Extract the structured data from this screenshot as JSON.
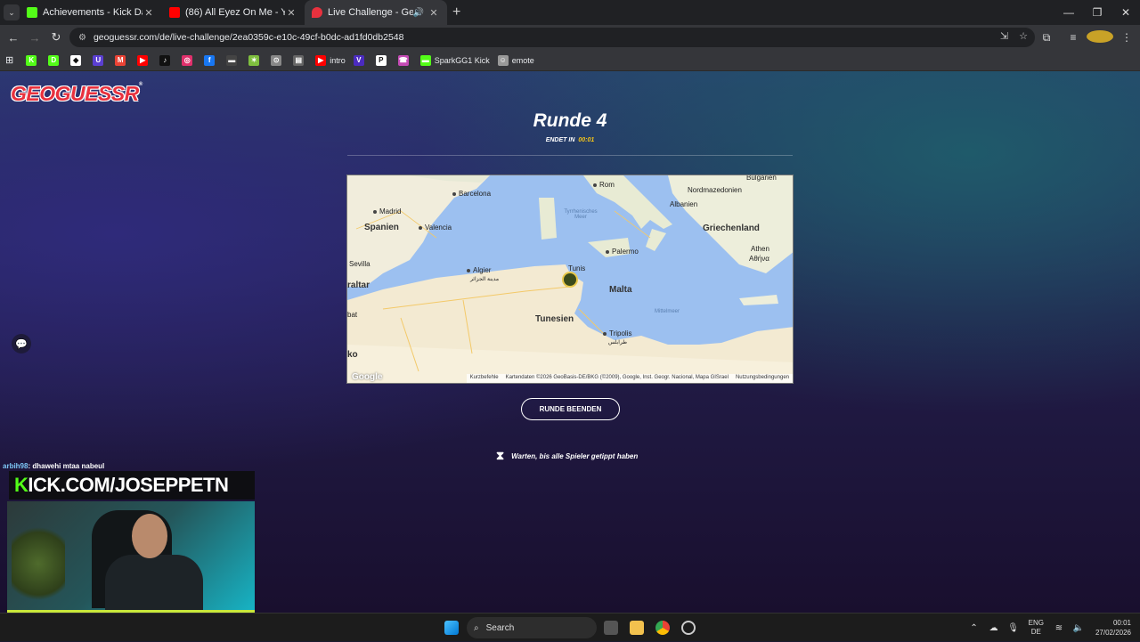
{
  "browser": {
    "tabs": [
      {
        "title": "Achievements - Kick Dashboard",
        "color": "#53fc18"
      },
      {
        "title": "(86) All Eyez On Me - YouTube",
        "color": "#ff0000"
      },
      {
        "title": "Live Challenge - GeoGuessr",
        "color": "#e8313e"
      }
    ],
    "url": "geoguessr.com/de/live-challenge/2ea0359c-e10c-49cf-b0dc-ad1fd0db2548",
    "bookmarks": [
      {
        "label": "",
        "color": "#53fc18",
        "glyph": "K"
      },
      {
        "label": "",
        "color": "#53fc18",
        "glyph": "D"
      },
      {
        "label": "",
        "color": "#ffffff",
        "glyph": "◆"
      },
      {
        "label": "",
        "color": "#5b3fd1",
        "glyph": "U"
      },
      {
        "label": "",
        "color": "#ea4335",
        "glyph": "M"
      },
      {
        "label": "",
        "color": "#ff0000",
        "glyph": "▶"
      },
      {
        "label": "",
        "color": "#111111",
        "glyph": "♪"
      },
      {
        "label": "",
        "color": "#e1306c",
        "glyph": "◎"
      },
      {
        "label": "",
        "color": "#1877f2",
        "glyph": "f"
      },
      {
        "label": "",
        "color": "#444444",
        "glyph": "▬"
      },
      {
        "label": "",
        "color": "#7fbf3f",
        "glyph": "✶"
      },
      {
        "label": "",
        "color": "#888888",
        "glyph": "⊙"
      },
      {
        "label": "",
        "color": "#666666",
        "glyph": "▤"
      },
      {
        "label": "intro",
        "color": "#ff0000",
        "glyph": "▶"
      },
      {
        "label": "",
        "color": "#4b2bbf",
        "glyph": "V"
      },
      {
        "label": "",
        "color": "#ffffff",
        "glyph": "P"
      },
      {
        "label": "",
        "color": "#c54bb5",
        "glyph": "☎"
      },
      {
        "label": "SparkGG1 Kick",
        "color": "#53fc18",
        "glyph": "▬"
      },
      {
        "label": "emote",
        "color": "#999999",
        "glyph": "☺"
      }
    ]
  },
  "game": {
    "logo": "GEOGUESSR",
    "round_title": "Runde 4",
    "ends_label": "ENDET IN",
    "timer": "00:01",
    "end_round_button": "RUNDE BEENDEN",
    "waiting_text": "Warten, bis alle Spieler getippt haben"
  },
  "map": {
    "labels": {
      "barcelona": "Barcelona",
      "rom": "Rom",
      "nordmazedonien": "Nordmazedonien",
      "bulgarien": "Bulgarien",
      "madrid": "Madrid",
      "albanien": "Albanien",
      "tyrrhenisches": "Tyrrhenisches Meer",
      "spanien": "Spanien",
      "valencia": "Valencia",
      "griechenland": "Griechenland",
      "palermo": "Palermo",
      "athen": "Athen",
      "athina": "Αθήνα",
      "sevilla": "Sevilla",
      "algier": "Algier",
      "algier_ar": "مدينة الجزائر",
      "tunis": "Tunis",
      "gibraltar": "raltar",
      "malta": "Malta",
      "rabat": "bat",
      "tunesien": "Tunesien",
      "mittelmeer": "Mittelmeer",
      "tripolis": "Tripolis",
      "tripolis_ar": "طرابلس",
      "marokko": "ko"
    },
    "footer": {
      "shortcuts": "Kurzbefehle",
      "attribution": "Kartendaten ©2026 GeoBasis-DE/BKG (©2009), Google, Inst. Geogr. Nacional, Mapa GISrael",
      "terms": "Nutzungsbedingungen"
    },
    "brand": "Google"
  },
  "stream": {
    "chat_user": "arbih98",
    "chat_text": ": dhawehi mtaa nabeul",
    "banner_k": "K",
    "banner_rest": "ICK.COM/JOSEPPETN"
  },
  "taskbar": {
    "search_placeholder": "Search",
    "lang_top": "ENG",
    "lang_bottom": "DE",
    "time": "00:01",
    "date": "27/02/2026"
  }
}
